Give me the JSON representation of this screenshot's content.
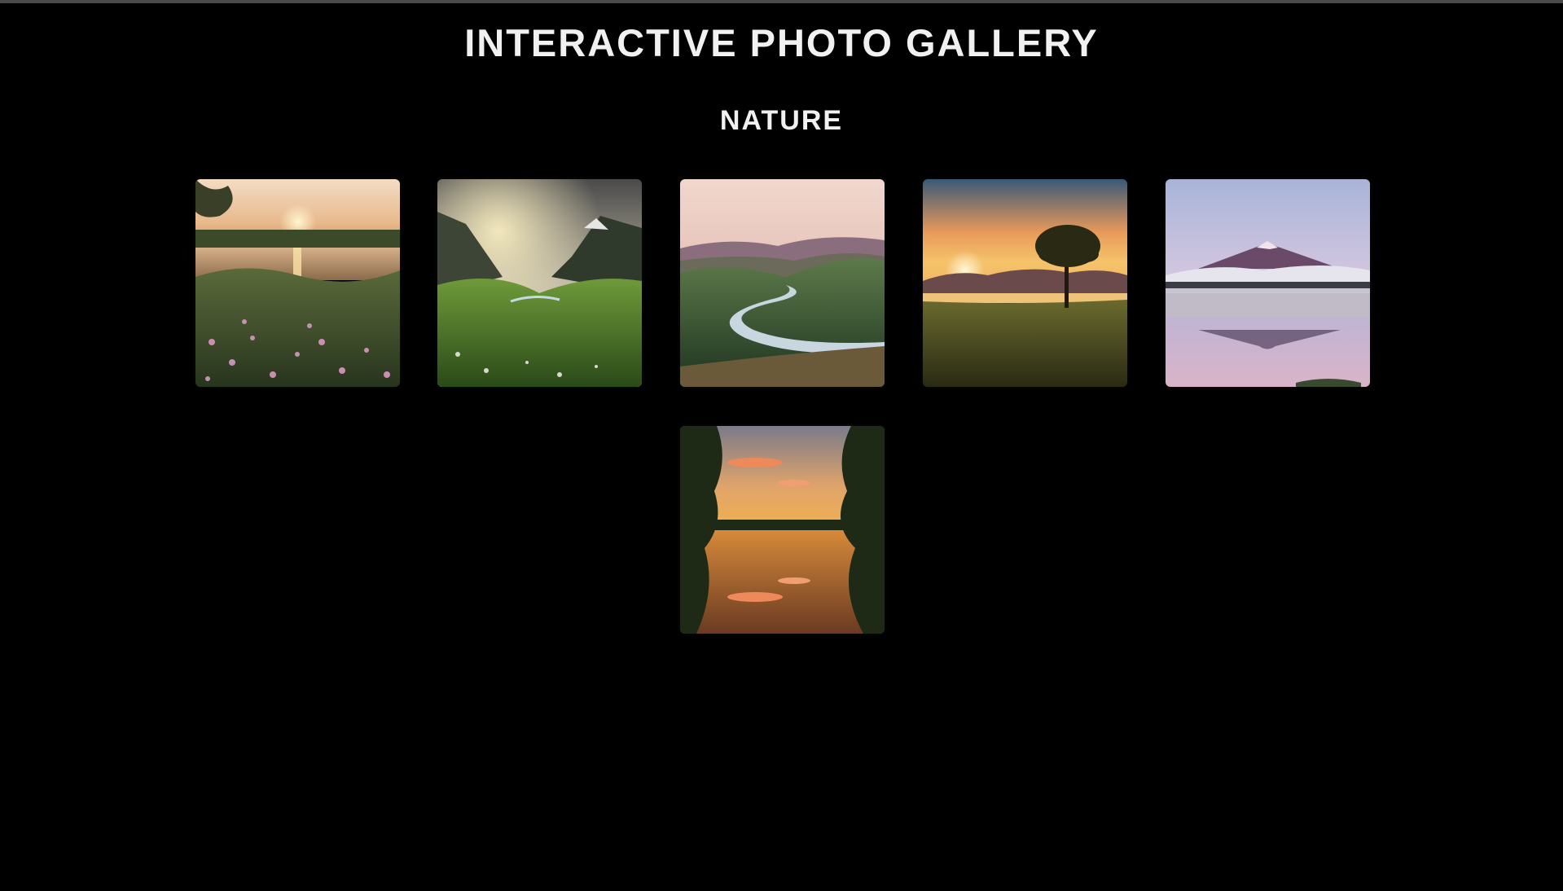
{
  "header": {
    "title": "INTERACTIVE PHOTO GALLERY"
  },
  "section": {
    "heading": "NATURE"
  },
  "gallery": {
    "photos": [
      {
        "subject": "lakeside sunset with wildflowers"
      },
      {
        "subject": "sunlit mountain valley with green meadow"
      },
      {
        "subject": "winding river through green hills at dusk"
      },
      {
        "subject": "lone tree on hill at sunset"
      },
      {
        "subject": "snowy mountain reflected in misty lake"
      },
      {
        "subject": "forest lake reflecting orange sunset"
      }
    ]
  },
  "colors": {
    "background": "#000000",
    "title_text": "#f1f1f1"
  }
}
